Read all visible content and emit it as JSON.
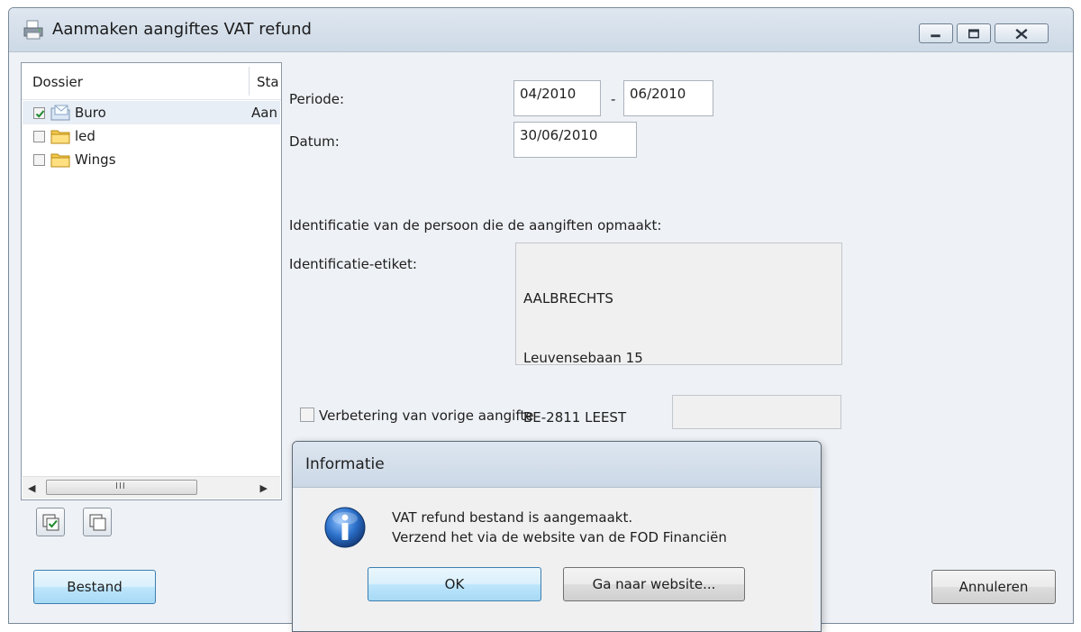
{
  "window": {
    "title": "Aanmaken aangiftes VAT refund"
  },
  "list": {
    "columns": {
      "dossier": "Dossier",
      "status": "Sta"
    },
    "rows": [
      {
        "label": "Buro",
        "status": "Aan",
        "checked": true,
        "icon": "envelope-folder-icon"
      },
      {
        "label": "led",
        "status": "",
        "checked": false,
        "icon": "folder-icon"
      },
      {
        "label": "Wings",
        "status": "",
        "checked": false,
        "icon": "folder-icon"
      }
    ],
    "scroll_grip": "III"
  },
  "form": {
    "periode_label": "Periode:",
    "periode_from": "04/2010",
    "periode_sep": "-",
    "periode_to": "06/2010",
    "datum_label": "Datum:",
    "datum_value": "30/06/2010",
    "ident_heading": "Identificatie van de persoon die de aangiften opmaakt:",
    "etiket_label": "Identificatie-etiket:",
    "etiket_lines": [
      "AALBRECHTS",
      "Leuvensebaan 15",
      "BE-2811 LEEST"
    ],
    "verbetering_label": "Verbetering van vorige aangifte",
    "verbetering_value": ""
  },
  "buttons": {
    "bestand": "Bestand",
    "annuleren": "Annuleren"
  },
  "dialog": {
    "title": "Informatie",
    "message_line1": "VAT refund bestand is aangemaakt.",
    "message_line2": "Verzend het via de website van de FOD Financiën",
    "ok": "OK",
    "website": "Ga naar website..."
  },
  "colors": {
    "accent": "#3c7fb1",
    "selected_row": "#e8eef6",
    "info_icon": "#2a6fc9"
  }
}
